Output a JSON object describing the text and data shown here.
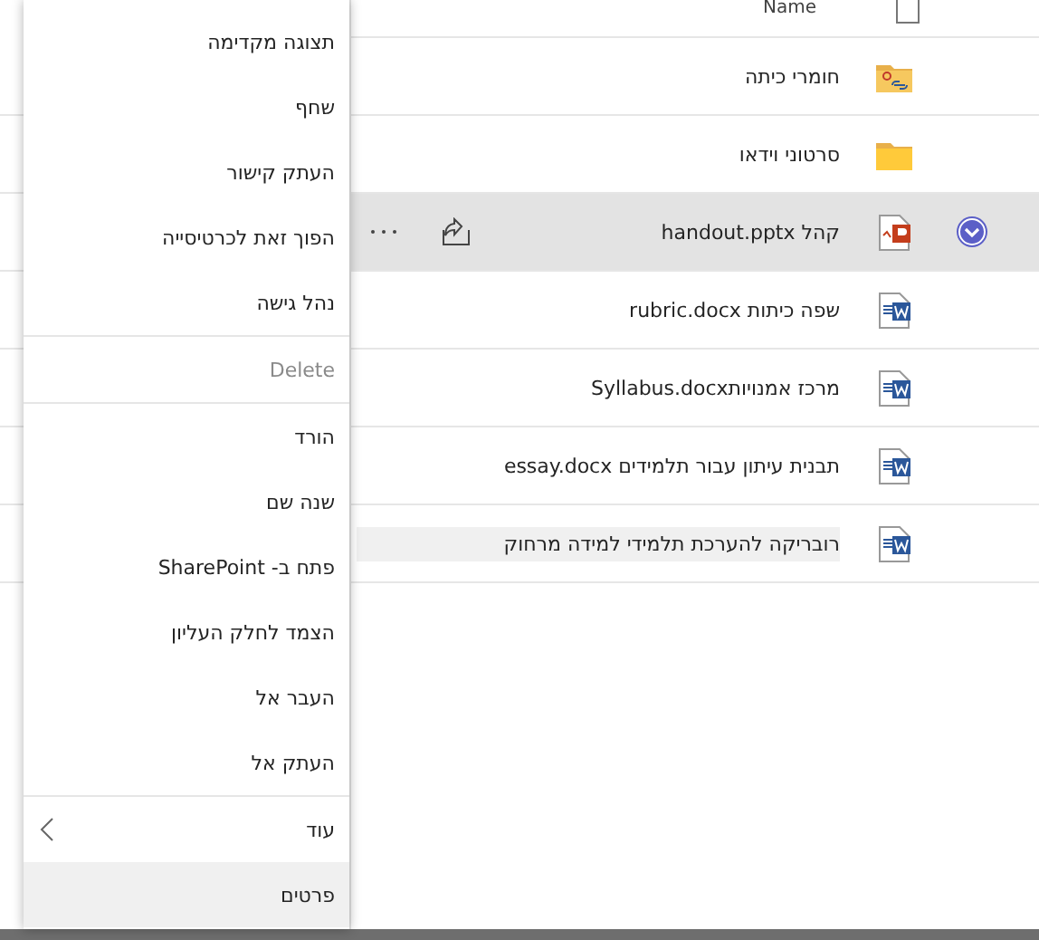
{
  "menu": {
    "items": [
      {
        "kind": "item",
        "label": "תצוגה מקדימה",
        "disabled": false,
        "selected": false
      },
      {
        "kind": "item",
        "label": "שחף",
        "disabled": false,
        "selected": false
      },
      {
        "kind": "item",
        "label": "העתק קישור",
        "disabled": false,
        "selected": false
      },
      {
        "kind": "item",
        "label": "הפוך זאת לכרטיסייה",
        "disabled": false,
        "selected": false
      },
      {
        "kind": "item",
        "label": "נהל גישה",
        "disabled": false,
        "selected": false
      },
      {
        "kind": "divider"
      },
      {
        "kind": "item",
        "label": "Delete",
        "disabled": true,
        "selected": false
      },
      {
        "kind": "divider"
      },
      {
        "kind": "item",
        "label": "הורד",
        "disabled": false,
        "selected": false
      },
      {
        "kind": "item",
        "label": "שנה שם",
        "disabled": false,
        "selected": false
      },
      {
        "kind": "item",
        "label": "פתח ב- SharePoint",
        "disabled": false,
        "selected": false
      },
      {
        "kind": "item",
        "label": "הצמד לחלק העליון",
        "disabled": false,
        "selected": false
      },
      {
        "kind": "item",
        "label": "העבר אל",
        "disabled": false,
        "selected": false
      },
      {
        "kind": "item",
        "label": "העתק אל",
        "disabled": false,
        "selected": false
      },
      {
        "kind": "divider"
      },
      {
        "kind": "submenu",
        "label": "עוד",
        "disabled": false,
        "selected": false
      },
      {
        "kind": "item",
        "label": "פרטים",
        "disabled": false,
        "selected": true
      }
    ]
  },
  "files": {
    "header": {
      "label": "Name",
      "checked": false
    },
    "rows": [
      {
        "name": "חומרי כיתה",
        "kind": "shared-folder",
        "selected": false,
        "highlighted": false
      },
      {
        "name": "סרטוני וידאו",
        "kind": "folder",
        "selected": false,
        "highlighted": false
      },
      {
        "name": "קהל handout.pptx",
        "kind": "powerpoint",
        "selected": true,
        "highlighted": false
      },
      {
        "name": "שפה כיתות rubric.docx",
        "kind": "word",
        "selected": false,
        "highlighted": false
      },
      {
        "name": "מרכז אמנויותSyllabus.docx",
        "kind": "word",
        "selected": false,
        "highlighted": false
      },
      {
        "name": "תבנית עיתון עבור תלמידים essay.docx",
        "kind": "word",
        "selected": false,
        "highlighted": false
      },
      {
        "name": "רובריקה להערכת תלמידי למידה מרחוק",
        "kind": "word",
        "selected": false,
        "highlighted": true
      }
    ]
  }
}
